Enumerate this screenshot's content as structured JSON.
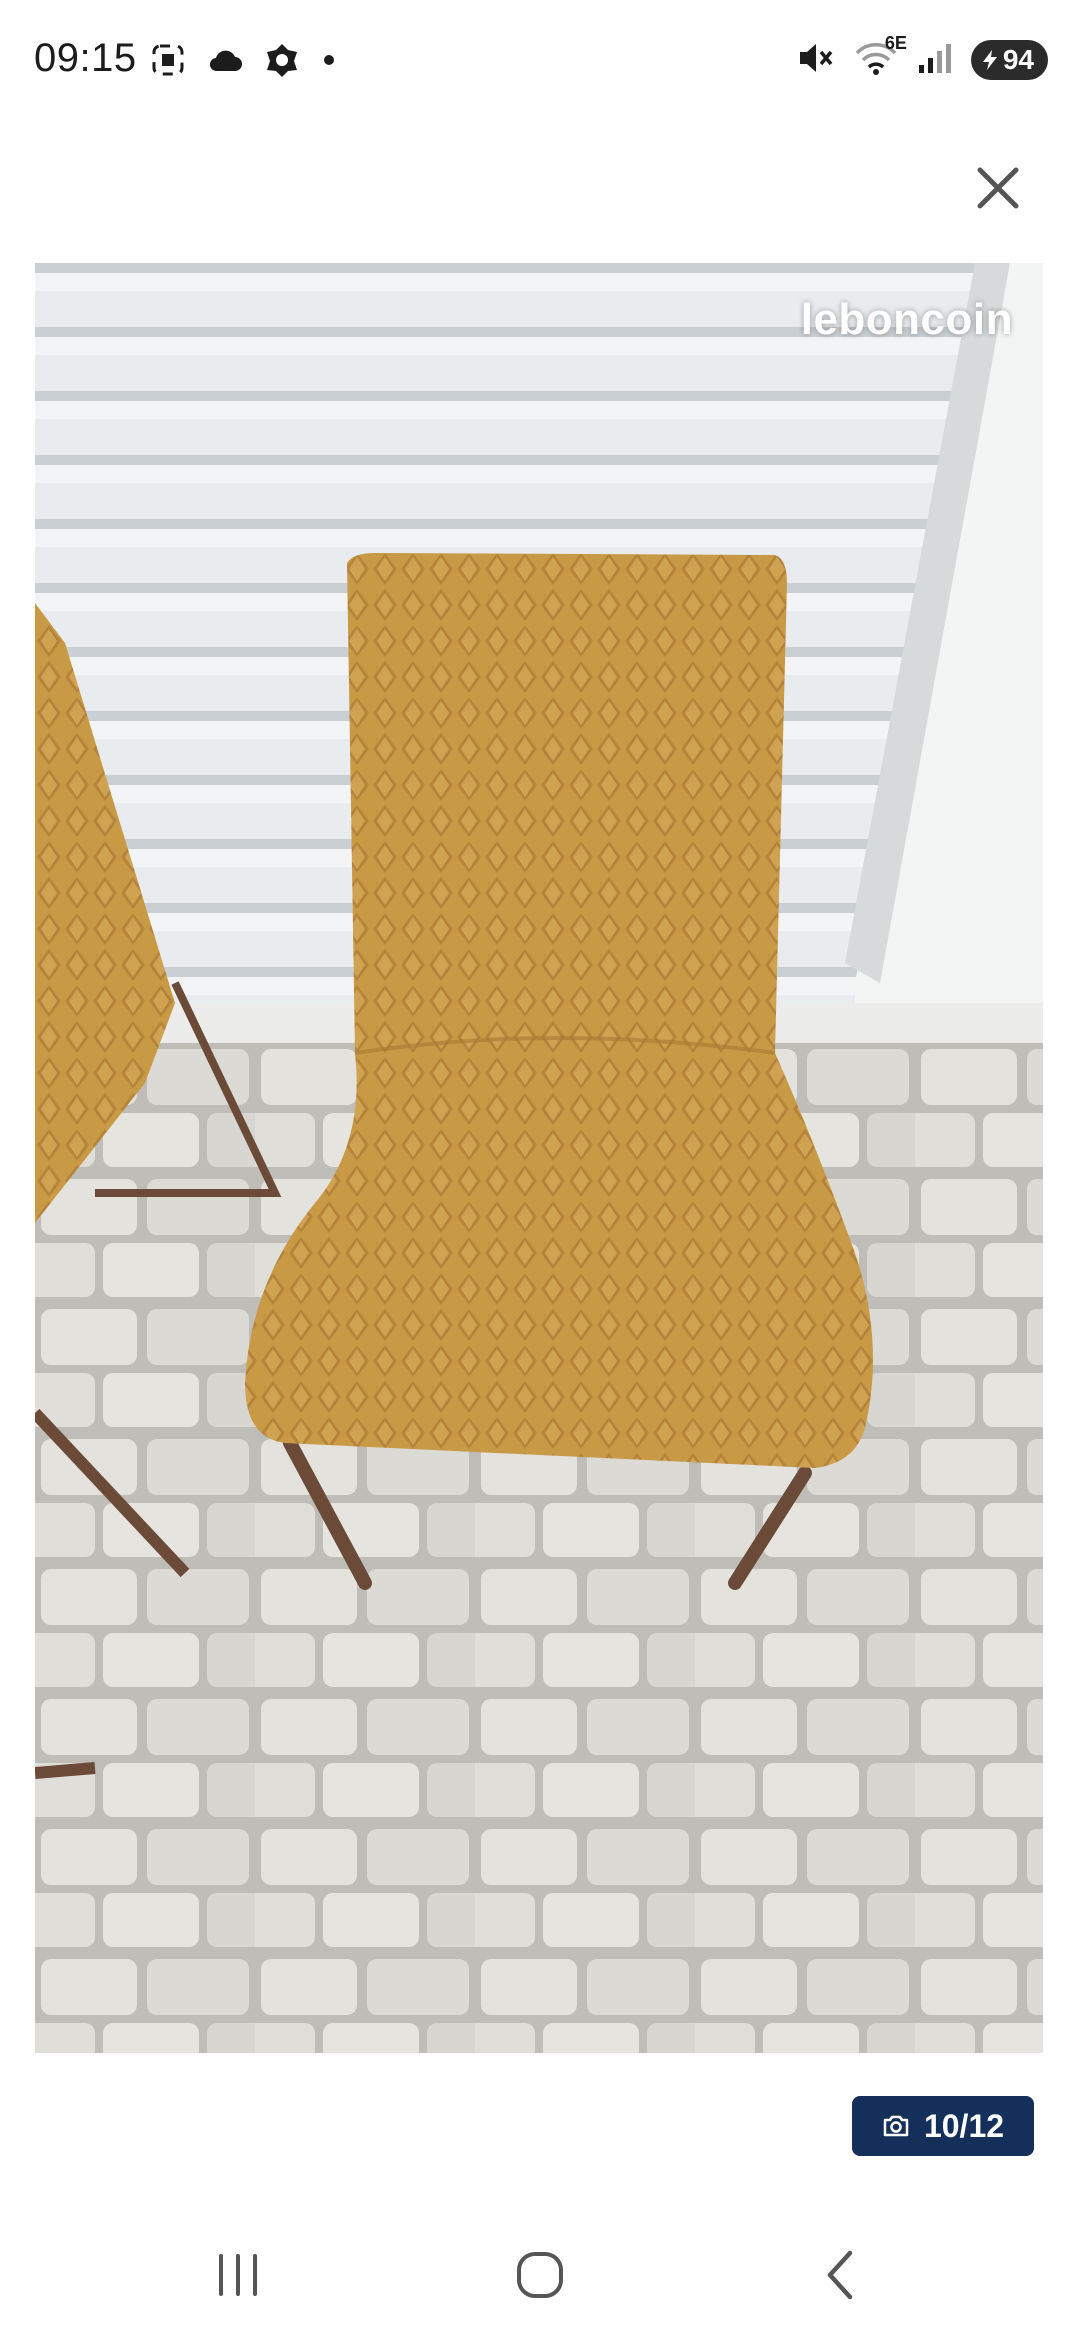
{
  "status_bar": {
    "time": "09:15",
    "network": "6E",
    "battery": "94",
    "icons_left": [
      "screenshot-icon",
      "cloud-icon",
      "app-badge-icon",
      "dot-icon"
    ],
    "icons_right": [
      "mute-icon",
      "wifi-icon",
      "signal-icon",
      "battery-icon"
    ]
  },
  "viewer": {
    "watermark": "leboncoin",
    "counter": "10/12",
    "counter_icon": "camera-icon",
    "close_icon": "close-icon",
    "accent_color": "#14305a"
  },
  "nav": {
    "items": [
      "recent-apps-icon",
      "home-icon",
      "back-icon"
    ]
  }
}
